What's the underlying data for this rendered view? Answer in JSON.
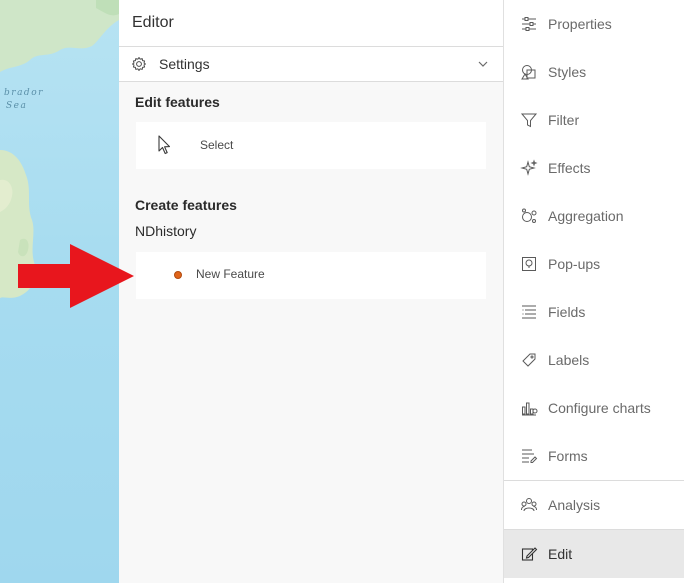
{
  "map": {
    "labels": [
      "brador",
      "Sea"
    ]
  },
  "editor": {
    "title": "Editor",
    "settings_label": "Settings",
    "edit_features_heading": "Edit features",
    "select_label": "Select",
    "create_features_heading": "Create features",
    "layer_name": "NDhistory",
    "new_feature_label": "New Feature",
    "feature_symbol_color": "#e0641a"
  },
  "nav": {
    "items": [
      {
        "label": "Properties",
        "icon": "sliders-icon"
      },
      {
        "label": "Styles",
        "icon": "shapes-icon"
      },
      {
        "label": "Filter",
        "icon": "filter-icon"
      },
      {
        "label": "Effects",
        "icon": "sparkle-icon"
      },
      {
        "label": "Aggregation",
        "icon": "aggregation-icon"
      },
      {
        "label": "Pop-ups",
        "icon": "popup-icon"
      },
      {
        "label": "Fields",
        "icon": "fields-icon"
      },
      {
        "label": "Labels",
        "icon": "label-icon"
      },
      {
        "label": "Configure charts",
        "icon": "chart-icon"
      },
      {
        "label": "Forms",
        "icon": "form-icon"
      },
      {
        "label": "Analysis",
        "icon": "analysis-icon"
      },
      {
        "label": "Edit",
        "icon": "edit-icon"
      }
    ],
    "active": "Edit"
  },
  "annotation": {
    "arrow_color": "#e8161d"
  }
}
